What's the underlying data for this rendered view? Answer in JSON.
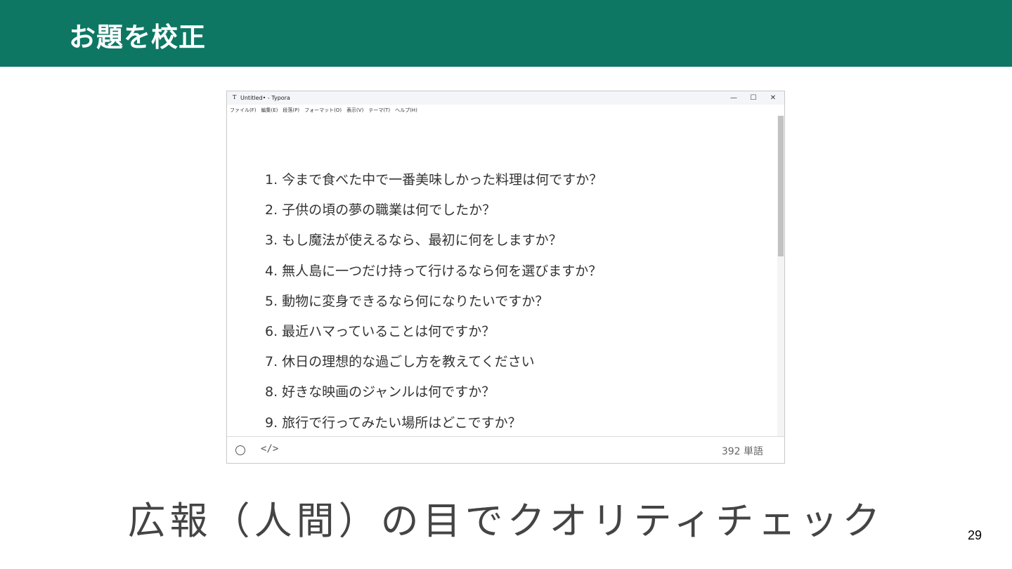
{
  "slide": {
    "title": "お題を校正",
    "caption": "広報（人間）の目でクオリティチェック",
    "page_number": "29",
    "header_color": "#0d7763"
  },
  "window": {
    "app_icon": "T",
    "title": "Untitled• - Typora",
    "controls": {
      "minimize": "—",
      "maximize": "☐",
      "close": "✕"
    },
    "menu": [
      "ファイル(F)",
      "編集(E)",
      "段落(P)",
      "フォーマット(O)",
      "表示(V)",
      "テーマ(T)",
      "ヘルプ(H)"
    ]
  },
  "editor": {
    "items": [
      "1. 今まで食べた中で一番美味しかった料理は何ですか？",
      "2. 子供の頃の夢の職業は何でしたか？",
      "3. もし魔法が使えるなら、最初に何をしますか？",
      "4. 無人島に一つだけ持って行けるなら何を選びますか？",
      "5. 動物に変身できるなら何になりたいですか？",
      "6. 最近ハマっていることは何ですか？",
      "7. 休日の理想的な過ごし方を教えてください",
      "8. 好きな映画のジャンルは何ですか？",
      "9. 旅行で行ってみたい場所はどこですか？"
    ]
  },
  "statusbar": {
    "outline_icon": "circle-icon",
    "source_icon_glyph": "</>",
    "word_count": "392 単語"
  }
}
